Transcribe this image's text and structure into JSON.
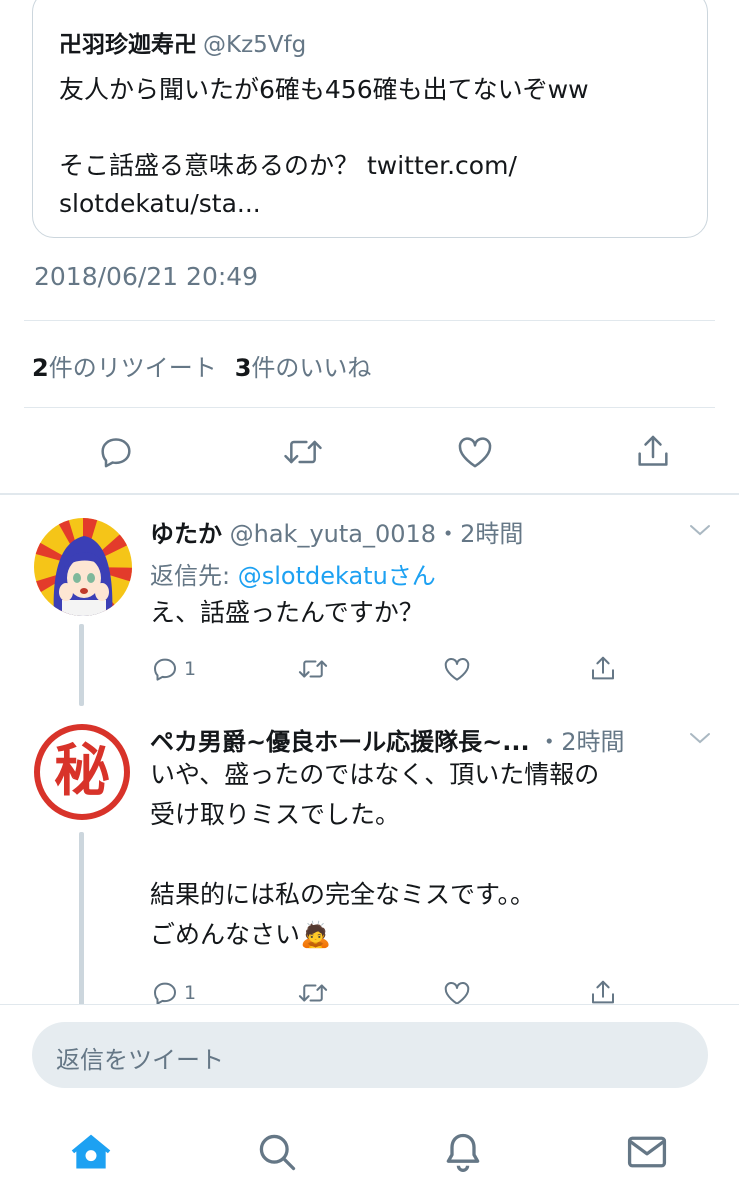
{
  "quote": {
    "name": "卍羽珍迦寿卍",
    "handle": "@Kz5Vfg",
    "text": "友人から聞いたが6確も456確も出てないぞww\n\nそこ話盛る意味あるのか？ twitter.com/\nslotdekatu/sta..."
  },
  "tweet": {
    "timestamp": "2018/06/21 20:49",
    "retweet_count": "2",
    "retweet_label": "件のリツイート",
    "like_count": "3",
    "like_label": "件のいいね"
  },
  "replies": [
    {
      "name": "ゆたか",
      "handle": "@hak_yuta_0018",
      "sep": "・",
      "time": "2時間",
      "replyto_prefix": "返信先: ",
      "replyto_user": "@slotdekatu",
      "replyto_suffix": "さん",
      "text": "え、話盛ったんですか？",
      "reply_count": "1"
    },
    {
      "name": "ペカ男爵~優良ホール応援隊長~...",
      "sep": "・",
      "time": "2時間",
      "text": "いや、盛ったのではなく、頂いた情報の\n受け取りミスでした。\n\n結果的には私の完全なミスです。。\nごめんなさい🙇",
      "avatar_char": "秘",
      "reply_count": "1"
    }
  ],
  "compose": {
    "placeholder": "返信をツイート"
  },
  "colors": {
    "accent": "#1da1f2",
    "muted": "#657786",
    "border": "#e1e8ed",
    "seal_red": "#d8332a"
  },
  "icons": [
    "reply-icon",
    "retweet-icon",
    "like-icon",
    "share-icon",
    "chevron-down-icon",
    "home-icon",
    "search-icon",
    "notifications-icon",
    "messages-icon"
  ]
}
